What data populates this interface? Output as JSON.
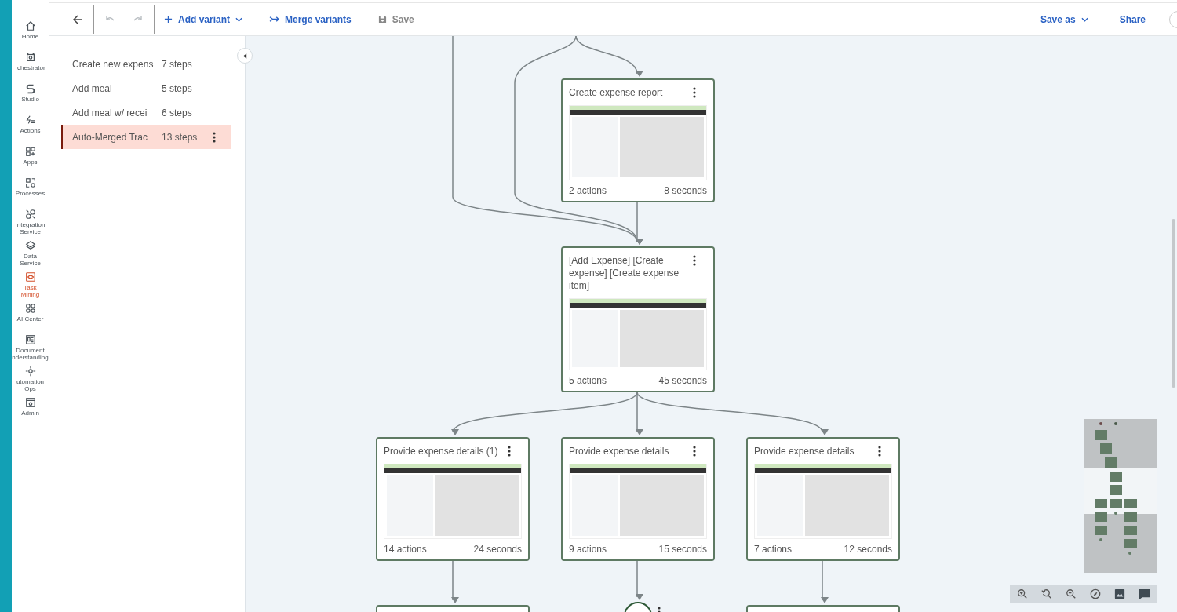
{
  "nav_rail": {
    "items": [
      {
        "lines": [
          "Home"
        ],
        "selected": false
      },
      {
        "lines": [
          "rchestrator"
        ],
        "selected": false
      },
      {
        "lines": [
          "Studio"
        ],
        "selected": false
      },
      {
        "lines": [
          "Actions"
        ],
        "selected": false
      },
      {
        "lines": [
          "Apps"
        ],
        "selected": false
      },
      {
        "lines": [
          "Processes"
        ],
        "selected": false
      },
      {
        "lines": [
          "Integration",
          "Service"
        ],
        "selected": false
      },
      {
        "lines": [
          "Data",
          "Service"
        ],
        "selected": false
      },
      {
        "lines": [
          "Task",
          "Mining"
        ],
        "selected": true
      },
      {
        "lines": [
          "AI Center"
        ],
        "selected": false
      },
      {
        "lines": [
          "Document",
          "nderstanding"
        ],
        "selected": false
      },
      {
        "lines": [
          "utomation",
          "Ops"
        ],
        "selected": false
      },
      {
        "lines": [
          "Admin"
        ],
        "selected": false
      }
    ]
  },
  "toolbar": {
    "undo_disabled": true,
    "redo_disabled": true,
    "actions": [
      {
        "label": "Add variant",
        "kind": "add",
        "disabled": false
      },
      {
        "label": "Merge variants",
        "kind": "merge",
        "disabled": false
      },
      {
        "label": "Save",
        "kind": "save",
        "disabled": true
      }
    ],
    "right": [
      {
        "label": "Save as",
        "kind": "dropdown"
      },
      {
        "label": "Share",
        "kind": "plain"
      }
    ]
  },
  "variants": [
    {
      "name": "Create new expens",
      "steps": "7 steps",
      "selected": false
    },
    {
      "name": "Add meal",
      "steps": "5 steps",
      "selected": false
    },
    {
      "name": "Add meal w/ recei",
      "steps": "6 steps",
      "selected": false
    },
    {
      "name": "Auto-Merged Trac",
      "steps": "13 steps",
      "selected": true
    }
  ],
  "flow": {
    "nodes": [
      {
        "kind": "step",
        "title": "Create expense report",
        "actions": "2 actions",
        "duration": "8 seconds"
      },
      {
        "kind": "step",
        "title": "[Add Expense] [Create expense] [Create expense item]",
        "actions": "5 actions",
        "duration": "45 seconds"
      },
      {
        "kind": "step",
        "title": "Provide expense details (1)",
        "actions": "14 actions",
        "duration": "24 seconds"
      },
      {
        "kind": "step",
        "title": "Provide expense details",
        "actions": "9 actions",
        "duration": "15 seconds"
      },
      {
        "kind": "step",
        "title": "Provide expense details",
        "actions": "7 actions",
        "duration": "12 seconds"
      },
      {
        "kind": "partial"
      },
      {
        "kind": "end"
      },
      {
        "kind": "partial"
      }
    ]
  }
}
